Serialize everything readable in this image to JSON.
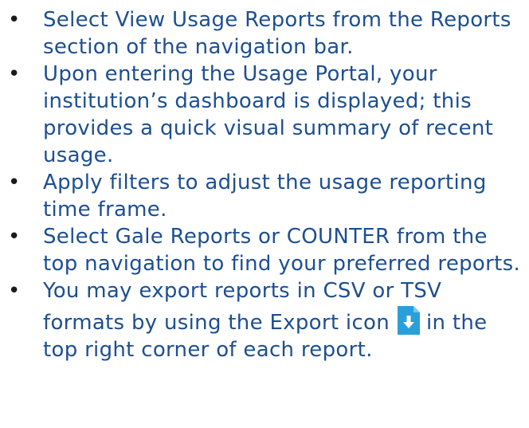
{
  "clipped_line": "…Reports from the",
  "items": [
    {
      "text": "Select View Usage Reports from the Reports section of the navigation bar."
    },
    {
      "text": "Upon entering the Usage Portal, your institution’s dashboard is displayed; this provides a quick visual summary of recent usage."
    },
    {
      "text": "Apply filters to adjust the usage reporting time frame."
    },
    {
      "text": "Select Gale Reports or COUNTER from the top navigation to find your preferred reports."
    },
    {
      "text_before": "You may export reports in CSV or TSV formats by using the Export icon",
      "text_after": "in the top right corner of each report."
    }
  ],
  "bullet_glyph": "•",
  "export_icon": {
    "name": "file-download-icon",
    "color": "#2a9fd8"
  },
  "colors": {
    "text": "#1d4f91",
    "bullet": "#1a1a1a"
  }
}
